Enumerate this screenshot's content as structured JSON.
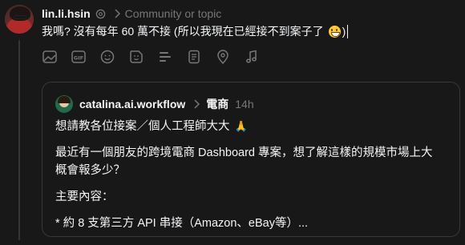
{
  "composer": {
    "username": "lin.li.hsin",
    "topic_placeholder": "Community or topic",
    "text": "我嗎? 沒有每年 60 萬不接 (所以我現在已經接不到案子了",
    "text_after_emoji": ")",
    "emoji": "grinning-squinting-face"
  },
  "toolbar": {
    "tools": [
      "image-icon",
      "gif-icon",
      "emoji-icon",
      "sticker-icon",
      "poll-icon",
      "document-icon",
      "location-icon",
      "music-icon"
    ]
  },
  "quote": {
    "username": "catalina.ai.workflow",
    "topic": "電商",
    "time": "14h",
    "title": "想請教各位接案／個人工程師大大",
    "title_emoji": "folded-hands",
    "body_line1": "最近有一個朋友的跨境電商 Dashboard 專案，想了解這樣的規模市場上大",
    "body_line2": "概會報多少？",
    "section_label": "主要內容：",
    "bullet": "* 約 8 支第三方 API 串接（Amazon、eBay等）..."
  },
  "colors": {
    "background": "#181818",
    "text": "#f3f5f7",
    "muted": "#777777",
    "border": "#383838"
  }
}
